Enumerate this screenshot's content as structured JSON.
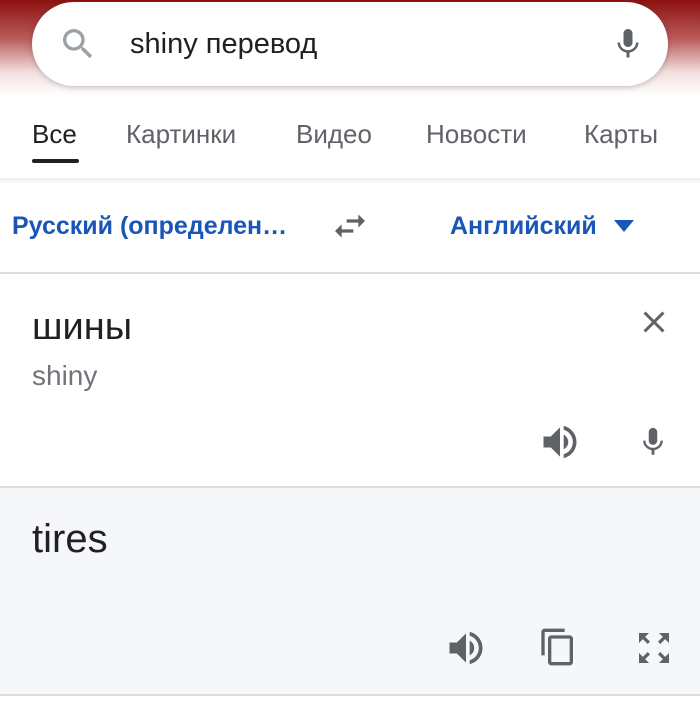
{
  "search": {
    "query": "shiny перевод",
    "icons": {
      "search": "search-icon",
      "mic": "mic-icon"
    }
  },
  "tabs": [
    {
      "label": "Все",
      "active": true
    },
    {
      "label": "Картинки",
      "active": false
    },
    {
      "label": "Видео",
      "active": false
    },
    {
      "label": "Новости",
      "active": false
    },
    {
      "label": "Карты",
      "active": false
    }
  ],
  "translator": {
    "source_language": "Русский (определен…",
    "target_language": "Английский",
    "source_text": "шины",
    "source_transliteration": "shiny",
    "target_text": "tires",
    "icons": {
      "swap": "swap-languages-icon",
      "dropdown": "caret-down-icon",
      "clear": "close-icon",
      "listen_source": "speaker-icon",
      "speak": "mic-icon",
      "listen_target": "speaker-icon",
      "copy": "copy-icon",
      "fullscreen": "fullscreen-icon"
    }
  },
  "colors": {
    "accent": "#1a56b8",
    "text_primary": "#202124",
    "text_secondary": "#5f6368",
    "icon": "#5f6368",
    "result_background": "#f6f7f9",
    "divider": "#dadce0",
    "top_band": "#8e1111"
  }
}
